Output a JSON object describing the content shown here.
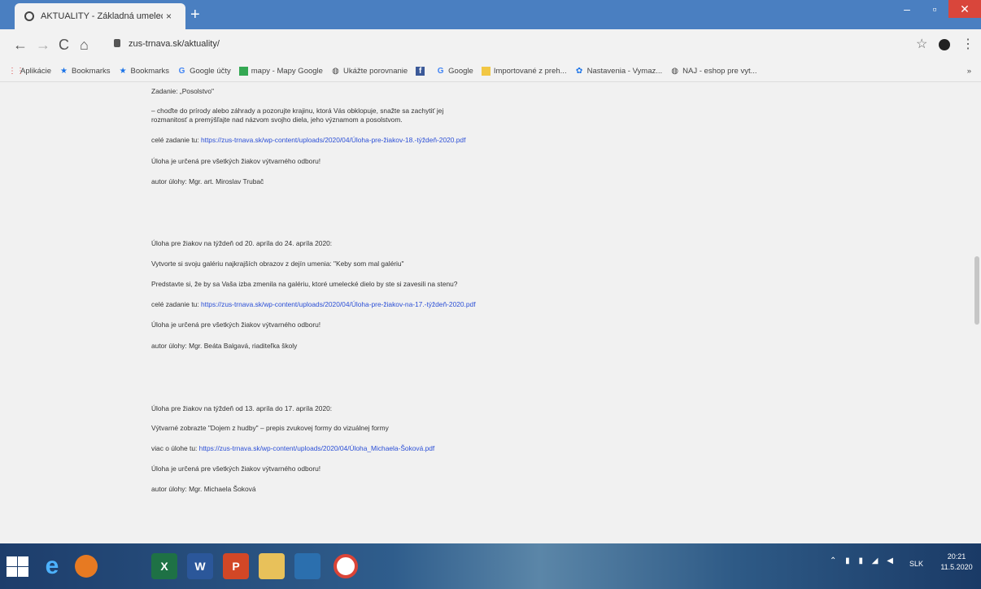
{
  "browser": {
    "tab_title": "AKTUALITY - Základná umelecká ...",
    "tab_close": "×",
    "new_tab": "+",
    "url": "zus-trnava.sk/aktuality/",
    "window_controls": {
      "minimize": "–",
      "maximize": "▫",
      "close": "✕"
    }
  },
  "nav": {
    "back": "←",
    "forward": "→",
    "reload": "C",
    "home": "⌂",
    "star": "☆",
    "menu": "⋮"
  },
  "bookmarks": [
    {
      "label": "Aplikácie",
      "icon": "apps-icon"
    },
    {
      "label": "Bookmarks",
      "icon": "star-icon"
    },
    {
      "label": "Bookmarks",
      "icon": "star-icon"
    },
    {
      "label": "Google účty",
      "icon": "google-icon"
    },
    {
      "label": "mapy - Mapy Google",
      "icon": "maps-icon"
    },
    {
      "label": "Ukážte porovnanie",
      "icon": "globe-icon"
    },
    {
      "label": "",
      "icon": "facebook-icon"
    },
    {
      "label": "Google",
      "icon": "google-icon"
    },
    {
      "label": "Importované z preh...",
      "icon": "folder-icon"
    },
    {
      "label": "Nastavenia - Vymaz...",
      "icon": "gear-icon"
    },
    {
      "label": "NAJ - eshop pre vyt...",
      "icon": "globe-icon"
    }
  ],
  "bookmarks_more": "»",
  "article": {
    "b1_title": "Zadanie: „Posolstvo\"",
    "b1_text1": "– choďte do prírody alebo záhrady a pozorujte krajinu, ktorá Vás obklopuje, snažte sa zachytiť jej",
    "b1_text2": "rozmanitosť a premýšľajte nad názvom svojho diela, jeho významom a posolstvom.",
    "b1_link_prefix": "celé zadanie tu:",
    "b1_link": "https://zus-trnava.sk/wp-content/uploads/2020/04/Úloha-pre-žiakov-18.-týždeň-2020.pdf",
    "b1_for": "Úloha je určená pre všetkých žiakov výtvarného odboru!",
    "b1_author": "autor úlohy: Mgr. art. Miroslav Trubač",
    "b2_title": "Úloha pre žiakov na týždeň od 20. apríla do 24. apríla 2020:",
    "b2_text1": "Vytvorte si svoju galériu najkrajších obrazov z dejín umenia: \"Keby som mal galériu\"",
    "b2_text2": "Predstavte si, že by sa Vaša izba zmenila na galériu, ktoré umelecké dielo by ste si zavesili na stenu?",
    "b2_link_prefix": "celé zadanie tu:",
    "b2_link": "https://zus-trnava.sk/wp-content/uploads/2020/04/Úloha-pre-žiakov-na-17.-týždeň-2020.pdf",
    "b2_for": "Úloha je určená pre všetkých žiakov výtvarného odboru!",
    "b2_author": "autor úlohy: Mgr. Beáta Balgavá, riaditeľka školy",
    "b3_title": "Úloha pre žiakov na týždeň od 13. apríla do 17. apríla 2020:",
    "b3_text1": "Výtvarné zobrazte \"Dojem z hudby\" – prepis zvukovej formy do vizuálnej formy",
    "b3_link_prefix": "viac o úlohe tu:",
    "b3_link": "https://zus-trnava.sk/wp-content/uploads/2020/04/Úloha_Michaela-Šoková.pdf",
    "b3_for": "Úloha je určená pre všetkých žiakov výtvarného odboru!",
    "b3_author": "autor úlohy: Mgr. Michaela Šoková"
  },
  "taskbar": {
    "excel": "X",
    "word": "W",
    "powerpoint": "P",
    "lang": "SLK",
    "time": "20:21",
    "date": "11.5.2020",
    "tray": "⌃ ▮ ▮ ◢ ◀"
  },
  "colors": {
    "titlebar": "#4a7fc1",
    "link": "#2b4fd6",
    "close": "#d9463b"
  }
}
